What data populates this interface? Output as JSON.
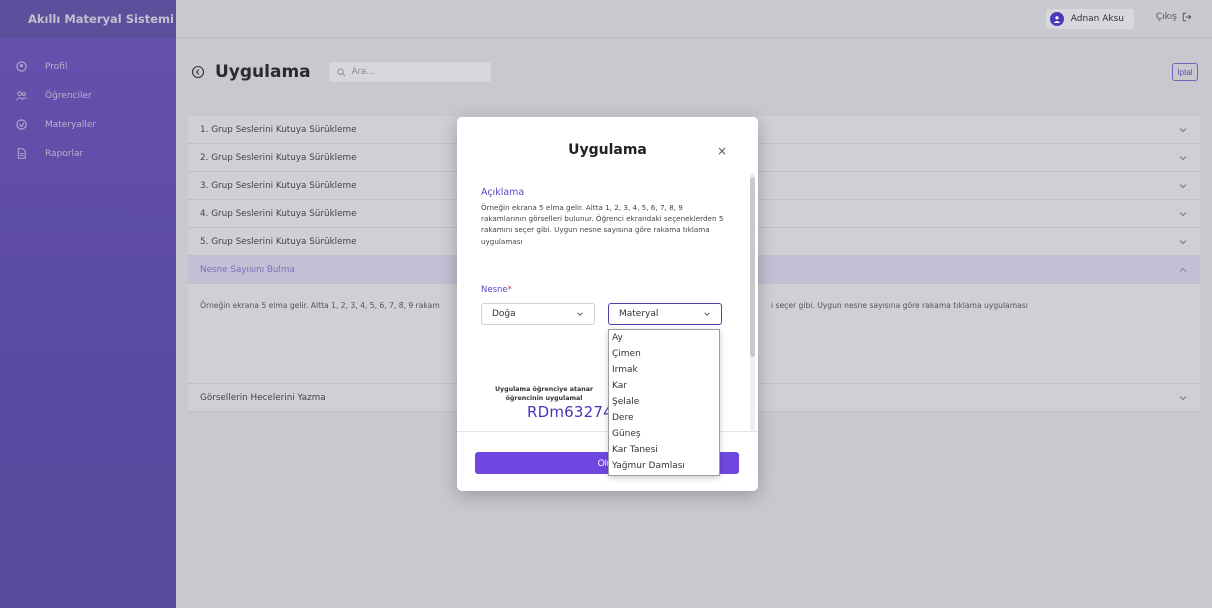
{
  "app": {
    "title": "Akıllı Materyal Sistemi"
  },
  "sidebar": {
    "items": [
      {
        "label": "Profil",
        "icon": "profile-icon"
      },
      {
        "label": "Öğrenciler",
        "icon": "users-icon"
      },
      {
        "label": "Materyaller",
        "icon": "materials-icon"
      },
      {
        "label": "Raporlar",
        "icon": "reports-icon"
      }
    ]
  },
  "topbar": {
    "user_name": "Adnan Aksu",
    "logout_label": "Çıkış"
  },
  "page": {
    "title": "Uygulama",
    "search_placeholder": "Ara...",
    "cancel_label": "İptal"
  },
  "accordion": {
    "items": [
      "1. Grup Seslerini Kutuya Sürükleme",
      "2. Grup Seslerini Kutuya Sürükleme",
      "3. Grup Seslerini Kutuya Sürükleme",
      "4. Grup Seslerini Kutuya Sürükleme",
      "5. Grup Seslerini Kutuya Sürükleme",
      "Nesne Sayısını Bulma",
      "Görsellerin Hecelerini Yazma"
    ],
    "active_body_left": "Örneğin ekrana 5 elma gelir. Altta 1, 2, 3, 4, 5, 6, 7, 8, 9 rakam",
    "active_body_right": "i seçer gibi. Uygun nesne sayısına göre rakama tıklama uygulaması"
  },
  "modal": {
    "title": "Uygulama",
    "close": "×",
    "description_label": "Açıklama",
    "description": "Örneğin ekrana 5 elma gelir. Altta 1, 2, 3, 4, 5, 6, 7, 8, 9 rakamlarının görselleri bulunur. Öğrenci ekrandaki seçeneklerden 5 rakamını seçer gibi. Uygun nesne sayısına göre rakama tıklama uygulaması",
    "nesne_label": "Nesne",
    "required_mark": "*",
    "select_category": "Doğa",
    "select_material": "Materyal",
    "note": "Uygulama öğrenciye atanar öğrencinin uygulamal",
    "code": "RDm632748",
    "create_label": "Oluş"
  },
  "dropdown": {
    "options": [
      "Ay",
      "Çimen",
      "Irmak",
      "Kar",
      "Şelale",
      "Dere",
      "Güneş",
      "Kar Tanesi",
      "Yağmur Damlası"
    ]
  }
}
